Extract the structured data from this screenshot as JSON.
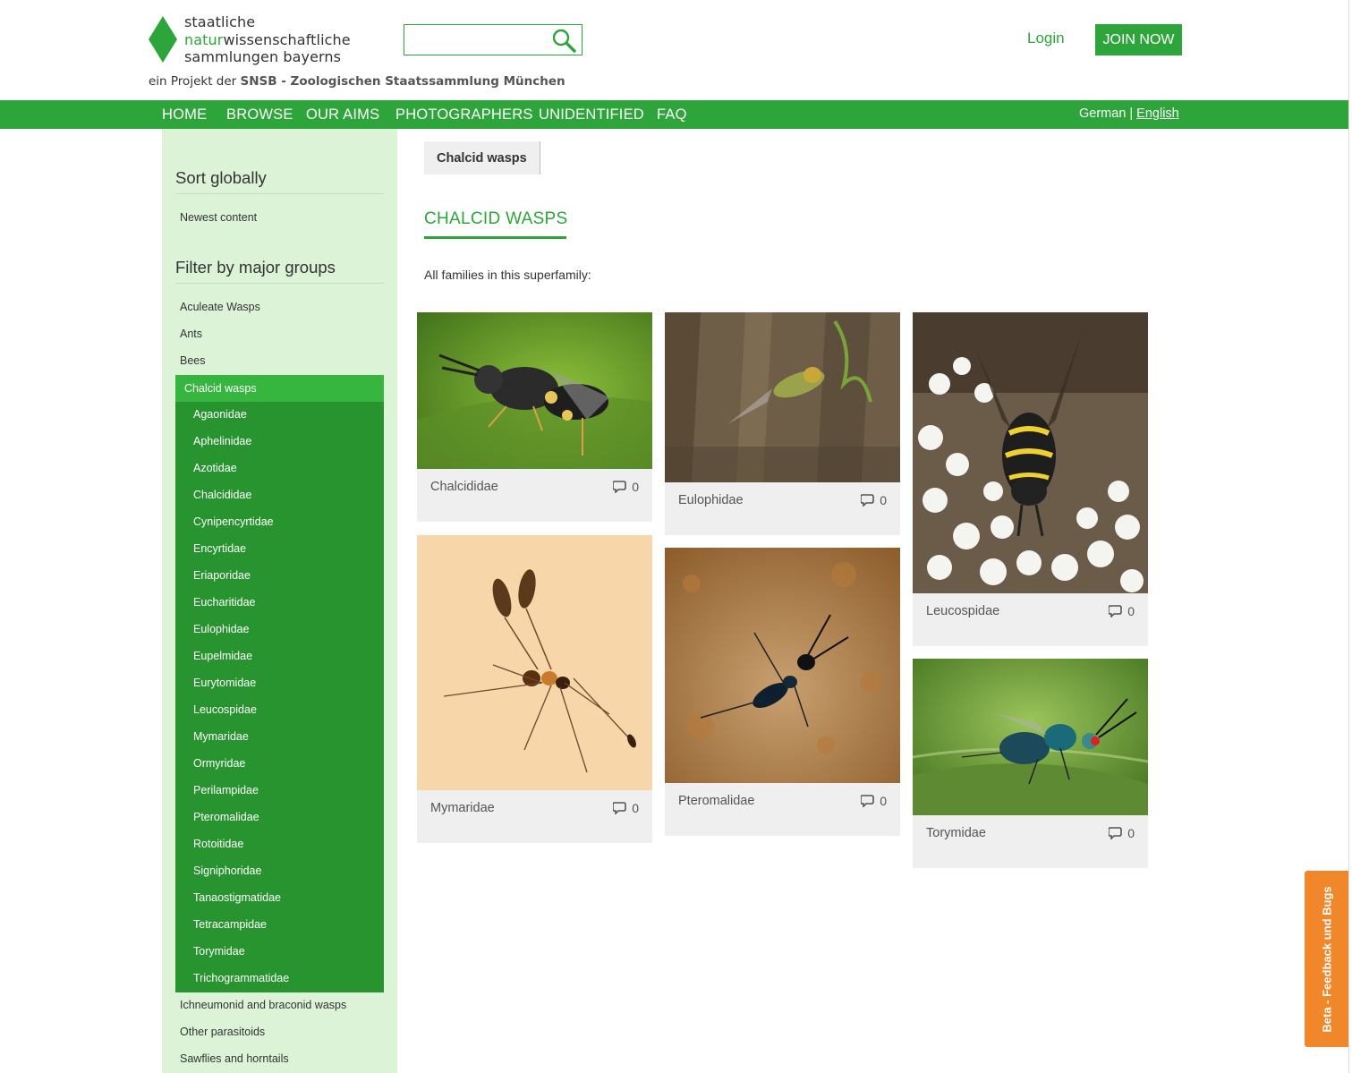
{
  "logo": {
    "line1": "staatliche",
    "line2_green": "natur",
    "line2_rest": "wissenschaftliche",
    "line3": "sammlungen bayerns",
    "brand_color": "#2ea53a"
  },
  "subtitle": {
    "prefix": "ein Projekt der",
    "bold": "SNSB - Zoologischen Staatssammlung München"
  },
  "search": {
    "placeholder": "",
    "value": "",
    "icon": "search-icon"
  },
  "header": {
    "login_label": "Login",
    "join_label": "JOIN NOW"
  },
  "nav": {
    "items": [
      "HOME",
      "BROWSE",
      "OUR AIMS",
      "PHOTOGRAPHERS",
      "UNIDENTIFIED",
      "FAQ"
    ],
    "lang_german": "German",
    "lang_sep": "|",
    "lang_english": "English"
  },
  "sidebar": {
    "sort_heading": "Sort globally",
    "sort_items": [
      "Newest content"
    ],
    "filter_heading": "Filter by major groups",
    "groups_before": [
      "Aculeate Wasps",
      "Ants",
      "Bees"
    ],
    "active_group": "Chalcid wasps",
    "subgroups": [
      "Agaonidae",
      "Aphelinidae",
      "Azotidae",
      "Chalcididae",
      "Cynipencyrtidae",
      "Encyrtidae",
      "Eriaporidae",
      "Eucharitidae",
      "Eulophidae",
      "Eupelmidae",
      "Eurytomidae",
      "Leucospidae",
      "Mymaridae",
      "Ormyridae",
      "Perilampidae",
      "Pteromalidae",
      "Rotoitidae",
      "Signiphoridae",
      "Tanaostigmatidae",
      "Tetracampidae",
      "Torymidae",
      "Trichogrammatidae"
    ],
    "groups_after": [
      "Ichneumonid and braconid wasps",
      "Other parasitoids",
      "Sawflies and horntails"
    ]
  },
  "main": {
    "breadcrumb": "Chalcid wasps",
    "title": "CHALCID WASPS",
    "intro": "All families in this superfamily:"
  },
  "cards": [
    {
      "name": "Chalcididae",
      "comments": "0"
    },
    {
      "name": "Eulophidae",
      "comments": "0"
    },
    {
      "name": "Leucospidae",
      "comments": "0"
    },
    {
      "name": "Mymaridae",
      "comments": "0"
    },
    {
      "name": "Pteromalidae",
      "comments": "0"
    },
    {
      "name": "Torymidae",
      "comments": "0"
    }
  ],
  "feedback_tab": {
    "label": "Beta - Feedback und Bugs",
    "color": "#f0872b"
  }
}
